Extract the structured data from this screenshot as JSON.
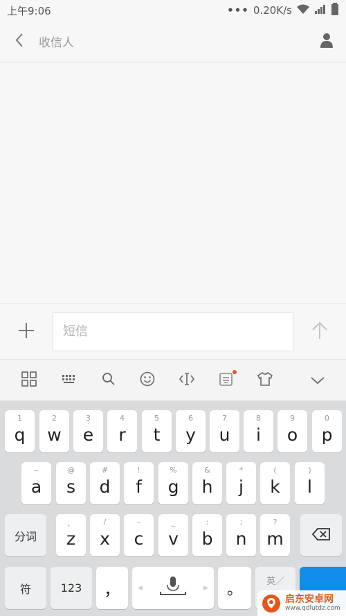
{
  "status_bar": {
    "time": "上午9:06",
    "dots": "•••",
    "net_speed": "0.20K/s",
    "icons": [
      "wifi-icon",
      "signal-icon",
      "battery-icon"
    ]
  },
  "header": {
    "recipient_placeholder": "收信人",
    "icons": [
      "back-arrow-icon",
      "contact-person-icon"
    ]
  },
  "compose": {
    "placeholder": "短信",
    "icons": [
      "plus-icon",
      "send-arrow-icon"
    ]
  },
  "keyboard_toolbar": {
    "icons": [
      "grid-menu-icon",
      "keyboard-icon",
      "search-icon",
      "emoji-icon",
      "cursor-icon",
      "sticker-icon",
      "skin-tshirt-icon",
      "chevron-down-icon"
    ],
    "notify_color": "#f0502a"
  },
  "keyboard": {
    "row1": [
      {
        "key": "q",
        "hint": "1"
      },
      {
        "key": "w",
        "hint": "2"
      },
      {
        "key": "e",
        "hint": "3"
      },
      {
        "key": "r",
        "hint": "4"
      },
      {
        "key": "t",
        "hint": "5"
      },
      {
        "key": "y",
        "hint": "6"
      },
      {
        "key": "u",
        "hint": "7"
      },
      {
        "key": "i",
        "hint": "8"
      },
      {
        "key": "o",
        "hint": "9"
      },
      {
        "key": "p",
        "hint": "0"
      }
    ],
    "row2": [
      {
        "key": "a",
        "hint": "~"
      },
      {
        "key": "s",
        "hint": "@"
      },
      {
        "key": "d",
        "hint": "#"
      },
      {
        "key": "f",
        "hint": "!"
      },
      {
        "key": "g",
        "hint": "%"
      },
      {
        "key": "h",
        "hint": "&"
      },
      {
        "key": "j",
        "hint": "*"
      },
      {
        "key": "k",
        "hint": "("
      },
      {
        "key": "l",
        "hint": ")"
      }
    ],
    "row3": [
      {
        "key": "z",
        "hint": "、"
      },
      {
        "key": "x",
        "hint": "/"
      },
      {
        "key": "c",
        "hint": "–"
      },
      {
        "key": "v",
        "hint": "_"
      },
      {
        "key": "b",
        "hint": ":"
      },
      {
        "key": "n",
        "hint": ";"
      },
      {
        "key": "m",
        "hint": "?"
      }
    ],
    "segment_label": "分词",
    "symbol_label": "符",
    "numeric_label": "123",
    "comma": "，",
    "period": "。",
    "lang_label": "英／",
    "accent": "#0f8de8"
  },
  "watermark": {
    "title": "启东安卓网",
    "url": "www.qdlutdz.com"
  }
}
